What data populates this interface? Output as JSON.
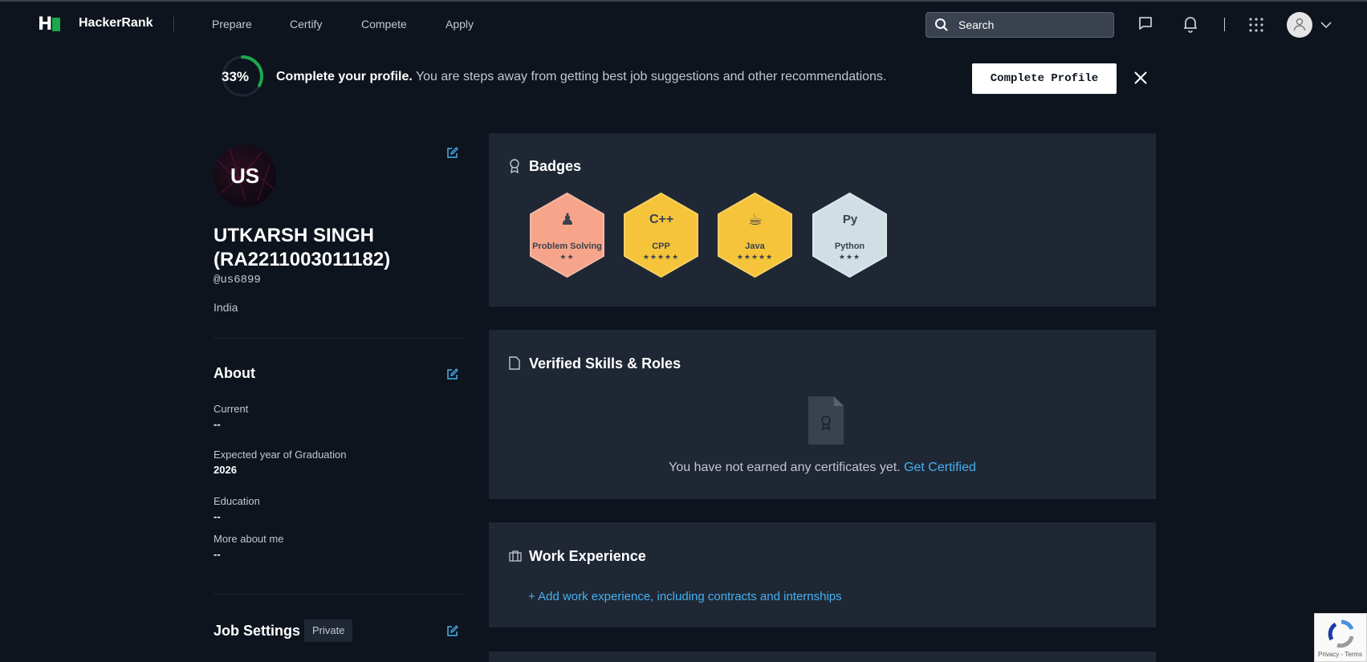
{
  "nav": {
    "brand": "HackerRank",
    "links": [
      "Prepare",
      "Certify",
      "Compete",
      "Apply"
    ],
    "search_placeholder": "Search"
  },
  "banner": {
    "progress_percent": 33,
    "progress_label": "33%",
    "headline": "Complete your profile.",
    "message": "You are steps away from getting best job suggestions and other recommendations.",
    "button_label": "Complete Profile"
  },
  "profile": {
    "initials": "US",
    "name": "UTKARSH SINGH (RA2211003011182)",
    "handle": "@us6899",
    "country": "India"
  },
  "about": {
    "title": "About",
    "fields": [
      {
        "label": "Current",
        "value": "--"
      },
      {
        "label": "Expected year of Graduation",
        "value": "2026"
      },
      {
        "label": "Education",
        "value": "--"
      },
      {
        "label": "More about me",
        "value": "--"
      }
    ]
  },
  "job_settings": {
    "title": "Job Settings",
    "visibility": "Private"
  },
  "badges": {
    "title": "Badges",
    "items": [
      {
        "name": "Problem Solving",
        "stars": 2,
        "star_text": "★★",
        "color": "#f7a58a",
        "icon": "problem-solving-icon",
        "glyph": "♟"
      },
      {
        "name": "CPP",
        "stars": 5,
        "star_text": "★★★★★",
        "color": "#f5c43a",
        "icon": "cpp-icon",
        "glyph": "C++"
      },
      {
        "name": "Java",
        "stars": 5,
        "star_text": "★★★★★",
        "color": "#f5c43a",
        "icon": "java-icon",
        "glyph": "☕"
      },
      {
        "name": "Python",
        "stars": 3,
        "star_text": "★★★",
        "color": "#cfdfe4",
        "icon": "python-icon",
        "glyph": "Py"
      }
    ]
  },
  "verified": {
    "title": "Verified Skills & Roles",
    "empty_message": "You have not earned any certificates yet.",
    "link": "Get Certified"
  },
  "work": {
    "title": "Work Experience",
    "add_link": "+ Add work experience, including contracts and internships"
  },
  "recaptcha": {
    "text": "Privacy - Terms"
  },
  "colors": {
    "background": "#0e141e",
    "card": "#1f2734",
    "accent_green": "#1ba94c",
    "link_blue": "#46b0f0"
  }
}
